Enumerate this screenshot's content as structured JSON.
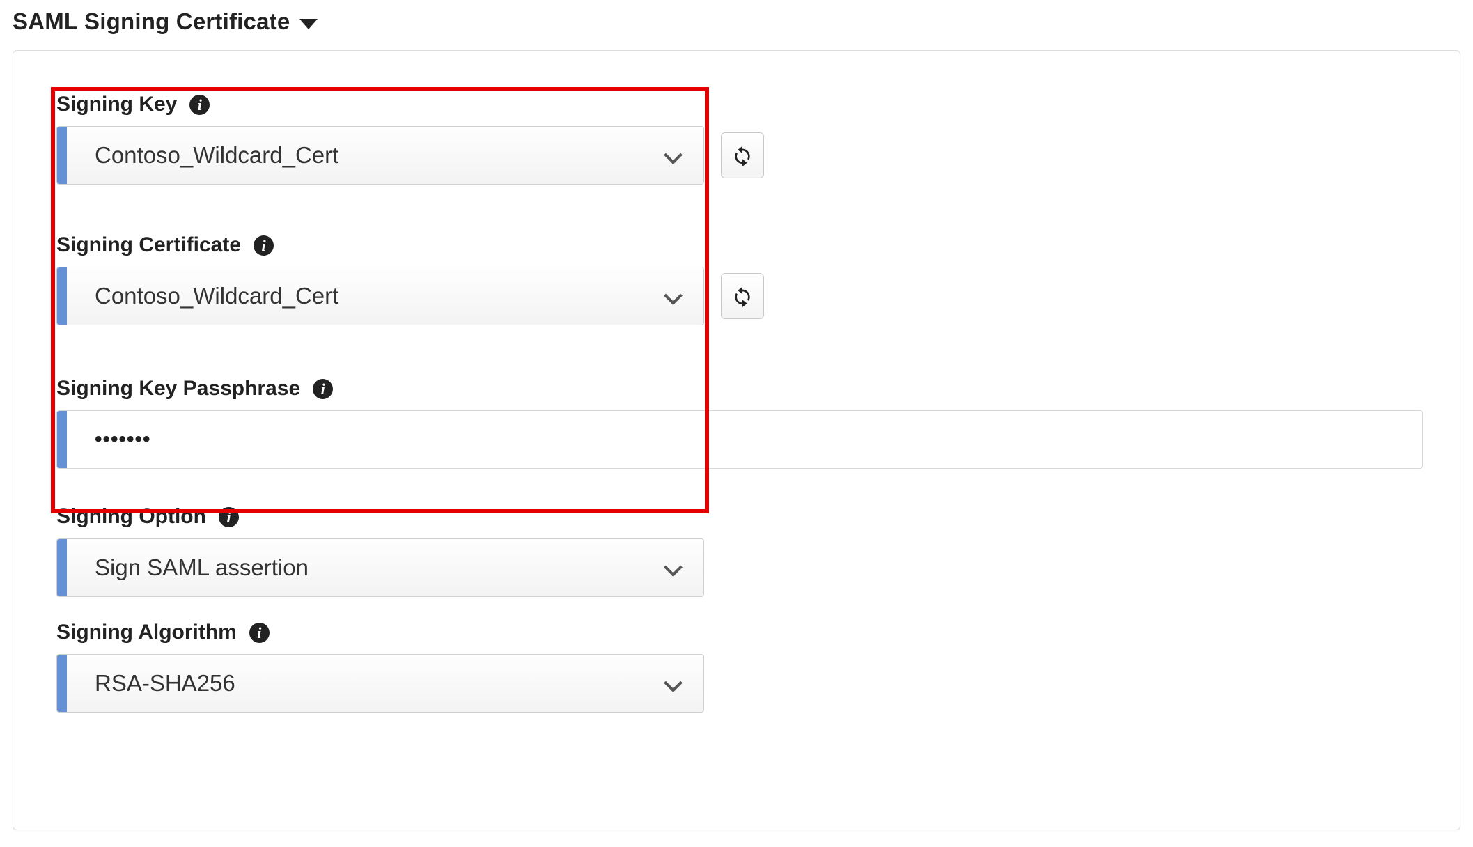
{
  "section": {
    "title": "SAML Signing Certificate"
  },
  "fields": {
    "signing_key": {
      "label": "Signing Key",
      "value": "Contoso_Wildcard_Cert"
    },
    "signing_certificate": {
      "label": "Signing Certificate",
      "value": "Contoso_Wildcard_Cert"
    },
    "signing_key_passphrase": {
      "label": "Signing Key Passphrase",
      "masked_value": "•••••••"
    },
    "signing_option": {
      "label": "Signing Option",
      "value": "Sign SAML assertion"
    },
    "signing_algorithm": {
      "label": "Signing Algorithm",
      "value": "RSA-SHA256"
    }
  }
}
